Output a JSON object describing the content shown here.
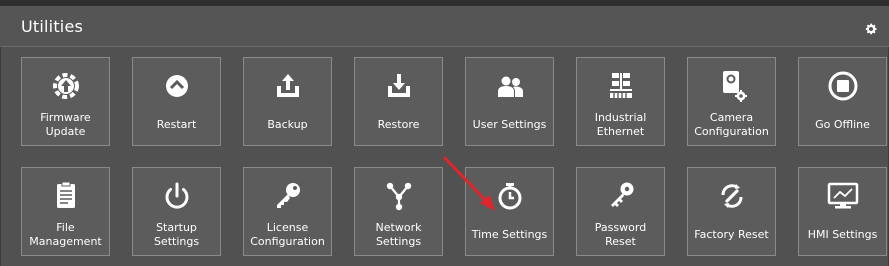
{
  "header": {
    "title": "Utilities",
    "settings_icon": "gear-icon"
  },
  "tiles": [
    {
      "label": "Firmware\nUpdate",
      "icon": "firmware-gear-icon"
    },
    {
      "label": "Restart",
      "icon": "restart-icon"
    },
    {
      "label": "Backup",
      "icon": "backup-upload-icon"
    },
    {
      "label": "Restore",
      "icon": "restore-download-icon"
    },
    {
      "label": "User Settings",
      "icon": "users-icon"
    },
    {
      "label": "Industrial\nEthernet",
      "icon": "network-tree-icon"
    },
    {
      "label": "Camera\nConfiguration",
      "icon": "camera-gear-icon"
    },
    {
      "label": "Go Offline",
      "icon": "stop-circle-icon"
    },
    {
      "label": "File\nManagement",
      "icon": "file-clipboard-icon"
    },
    {
      "label": "Startup\nSettings",
      "icon": "power-icon"
    },
    {
      "label": "License\nConfiguration",
      "icon": "key-icon"
    },
    {
      "label": "Network\nSettings",
      "icon": "network-nodes-icon"
    },
    {
      "label": "Time Settings",
      "icon": "stopwatch-icon"
    },
    {
      "label": "Password\nReset",
      "icon": "password-key-icon"
    },
    {
      "label": "Factory Reset",
      "icon": "wrench-refresh-icon"
    },
    {
      "label": "HMI Settings",
      "icon": "monitor-icon"
    }
  ],
  "annotation": {
    "type": "red-arrow",
    "points_to": "Time Settings",
    "color": "#e0262a"
  },
  "colors": {
    "panel_bg": "#515151",
    "tile_bg": "#5c5c5c",
    "tile_border": "#8a8a8a",
    "text": "#ffffff"
  }
}
